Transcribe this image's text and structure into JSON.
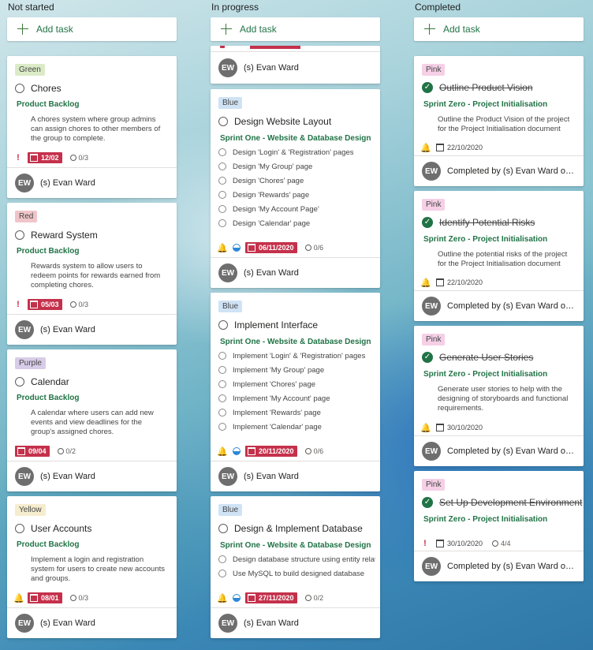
{
  "add_task_label": "Add task",
  "assignee_initials": "EW",
  "columns": [
    {
      "title": "Not started",
      "cards": [
        {
          "label": "Green",
          "title": "Chores",
          "bucket": "Product Backlog",
          "description": "A chores system where group admins can assign chores to other members of the group to complete.",
          "due": "12/02",
          "checklist_count": "0/3",
          "assignee": "(s) Evan Ward"
        },
        {
          "label": "Red",
          "title": "Reward System",
          "bucket": "Product Backlog",
          "description": "Rewards system to allow users to redeem points for rewards earned from completing chores.",
          "due": "05/03",
          "checklist_count": "0/3",
          "assignee": "(s) Evan Ward"
        },
        {
          "label": "Purple",
          "title": "Calendar",
          "bucket": "Product Backlog",
          "description": "A calendar where users can add new events and view deadlines for the group's assigned chores.",
          "due": "09/04",
          "checklist_count": "0/2",
          "assignee": "(s) Evan Ward"
        },
        {
          "label": "Yellow",
          "title": "User Accounts",
          "bucket": "Product Backlog",
          "description": "Implement a login and registration system for users to create new accounts and groups.",
          "due": "08/01",
          "checklist_count": "0/3",
          "assignee": "(s) Evan Ward"
        }
      ]
    },
    {
      "title": "In progress",
      "partial_card": {
        "assignee": "(s) Evan Ward"
      },
      "cards": [
        {
          "label": "Blue",
          "title": "Design Website Layout",
          "bucket": "Sprint One - Website & Database Design",
          "checklist": [
            "Design 'Login' & 'Registration' pages",
            "Design 'My Group' page",
            "Design 'Chores' page",
            "Design 'Rewards' page",
            "Design 'My Account Page'",
            "Design 'Calendar' page"
          ],
          "due": "06/11/2020",
          "checklist_count": "0/6",
          "assignee": "(s) Evan Ward"
        },
        {
          "label": "Blue",
          "title": "Implement Interface",
          "bucket": "Sprint One - Website & Database Design",
          "checklist": [
            "Implement 'Login' & 'Registration' pages",
            "Implement 'My Group' page",
            "Implement 'Chores' page",
            "Implement 'My Account' page",
            "Implement 'Rewards' page",
            "Implement 'Calendar' page"
          ],
          "due": "20/11/2020",
          "checklist_count": "0/6",
          "assignee": "(s) Evan Ward"
        },
        {
          "label": "Blue",
          "title": "Design & Implement Database",
          "bucket": "Sprint One - Website & Database Design",
          "checklist": [
            "Design database structure using entity relatic",
            "Use MySQL to build designed database"
          ],
          "due": "27/11/2020",
          "checklist_count": "0/2",
          "assignee": "(s) Evan Ward"
        }
      ]
    },
    {
      "title": "Completed",
      "cards": [
        {
          "label": "Pink",
          "title": "Outline Product Vision",
          "bucket": "Sprint Zero - Project Initialisation",
          "description": "Outline the Product Vision of the project for the Project Initialisation document",
          "due": "22/10/2020",
          "completed_by": "Completed by (s) Evan Ward on ..."
        },
        {
          "label": "Pink",
          "title": "Identify Potential Risks",
          "bucket": "Sprint Zero - Project Initialisation",
          "description": "Outline the potential risks of the project for the Project Initialisation document",
          "due": "22/10/2020",
          "completed_by": "Completed by (s) Evan Ward on ..."
        },
        {
          "label": "Pink",
          "title": "Generate User Stories",
          "bucket": "Sprint Zero - Project Initialisation",
          "description": "Generate user stories to help with the designing of storyboards and functional requirements.",
          "due": "30/10/2020",
          "completed_by": "Completed by (s) Evan Ward on ..."
        },
        {
          "label": "Pink",
          "title": "Set Up Development Environment",
          "bucket": "Sprint Zero - Project Initialisation",
          "due": "30/10/2020",
          "checklist_count": "4/4",
          "completed_by": "Completed by (s) Evan Ward on ..."
        }
      ]
    }
  ]
}
